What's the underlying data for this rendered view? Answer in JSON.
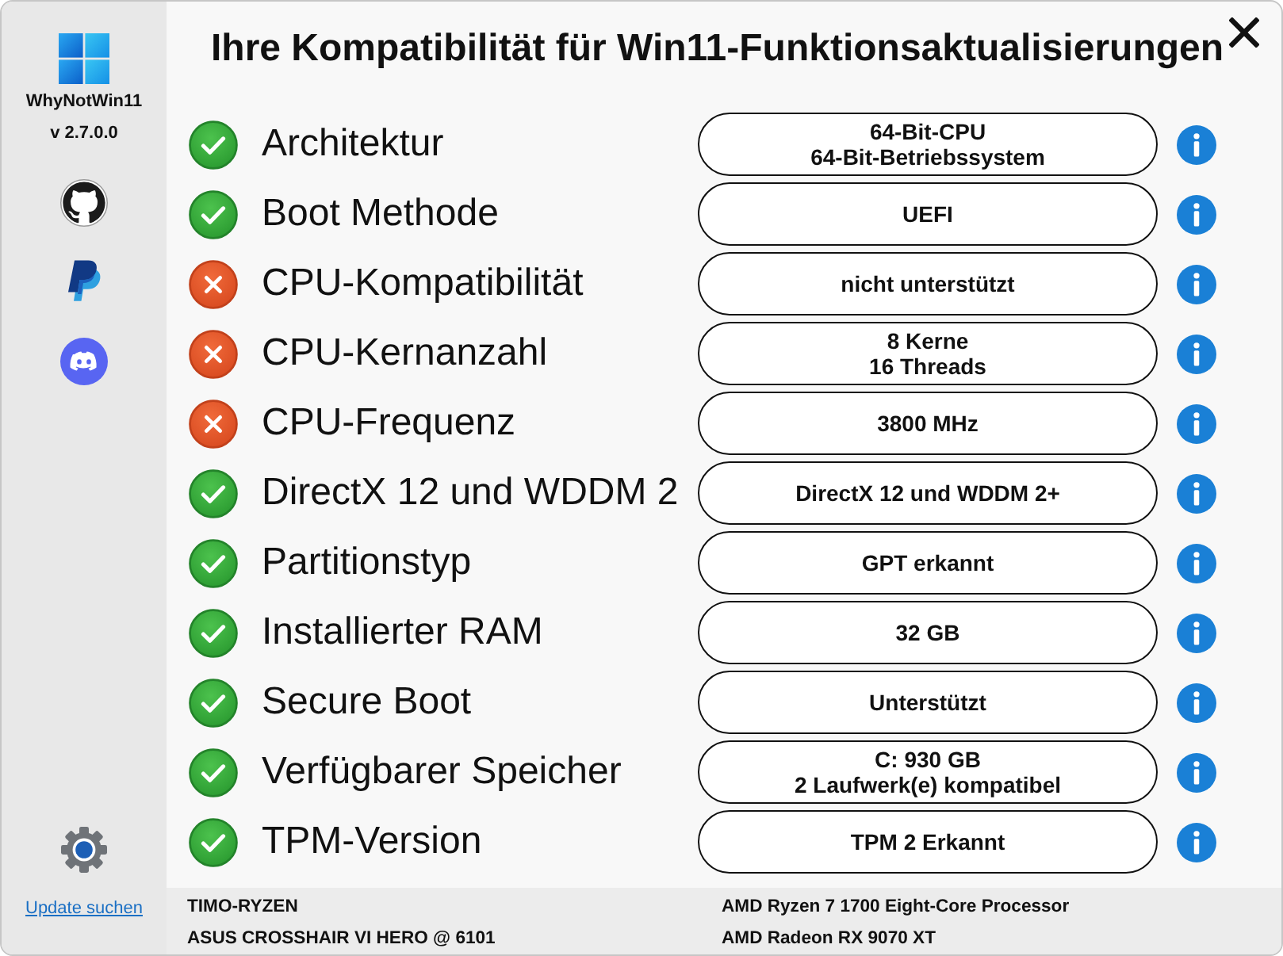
{
  "sidebar": {
    "app_name": "WhyNotWin11",
    "version": "v 2.7.0.0",
    "update_link": "Update suchen"
  },
  "title": "Ihre Kompatibilität für Win11-Funktionsaktualisierungen",
  "checks": [
    {
      "label": "Architektur",
      "passed": true,
      "value": "64-Bit-CPU\n64-Bit-Betriebssystem"
    },
    {
      "label": "Boot Methode",
      "passed": true,
      "value": "UEFI"
    },
    {
      "label": "CPU-Kompatibilität",
      "passed": false,
      "value": "nicht unterstützt"
    },
    {
      "label": "CPU-Kernanzahl",
      "passed": false,
      "value": "8 Kerne\n16 Threads"
    },
    {
      "label": "CPU-Frequenz",
      "passed": false,
      "value": "3800 MHz"
    },
    {
      "label": "DirectX 12 und WDDM 2",
      "passed": true,
      "value": "DirectX 12 und WDDM 2+"
    },
    {
      "label": "Partitionstyp",
      "passed": true,
      "value": "GPT erkannt"
    },
    {
      "label": "Installierter RAM",
      "passed": true,
      "value": "32 GB"
    },
    {
      "label": "Secure Boot",
      "passed": true,
      "value": "Unterstützt"
    },
    {
      "label": "Verfügbarer Speicher",
      "passed": true,
      "value": "C: 930 GB\n2 Laufwerk(e) kompatibel"
    },
    {
      "label": "TPM-Version",
      "passed": true,
      "value": "TPM 2 Erkannt"
    }
  ],
  "footer": {
    "left": [
      "TIMO-RYZEN",
      "ASUS CROSSHAIR VI HERO @ 6101"
    ],
    "right": [
      "AMD Ryzen 7 1700 Eight-Core Processor",
      "AMD Radeon RX 9070 XT"
    ]
  }
}
